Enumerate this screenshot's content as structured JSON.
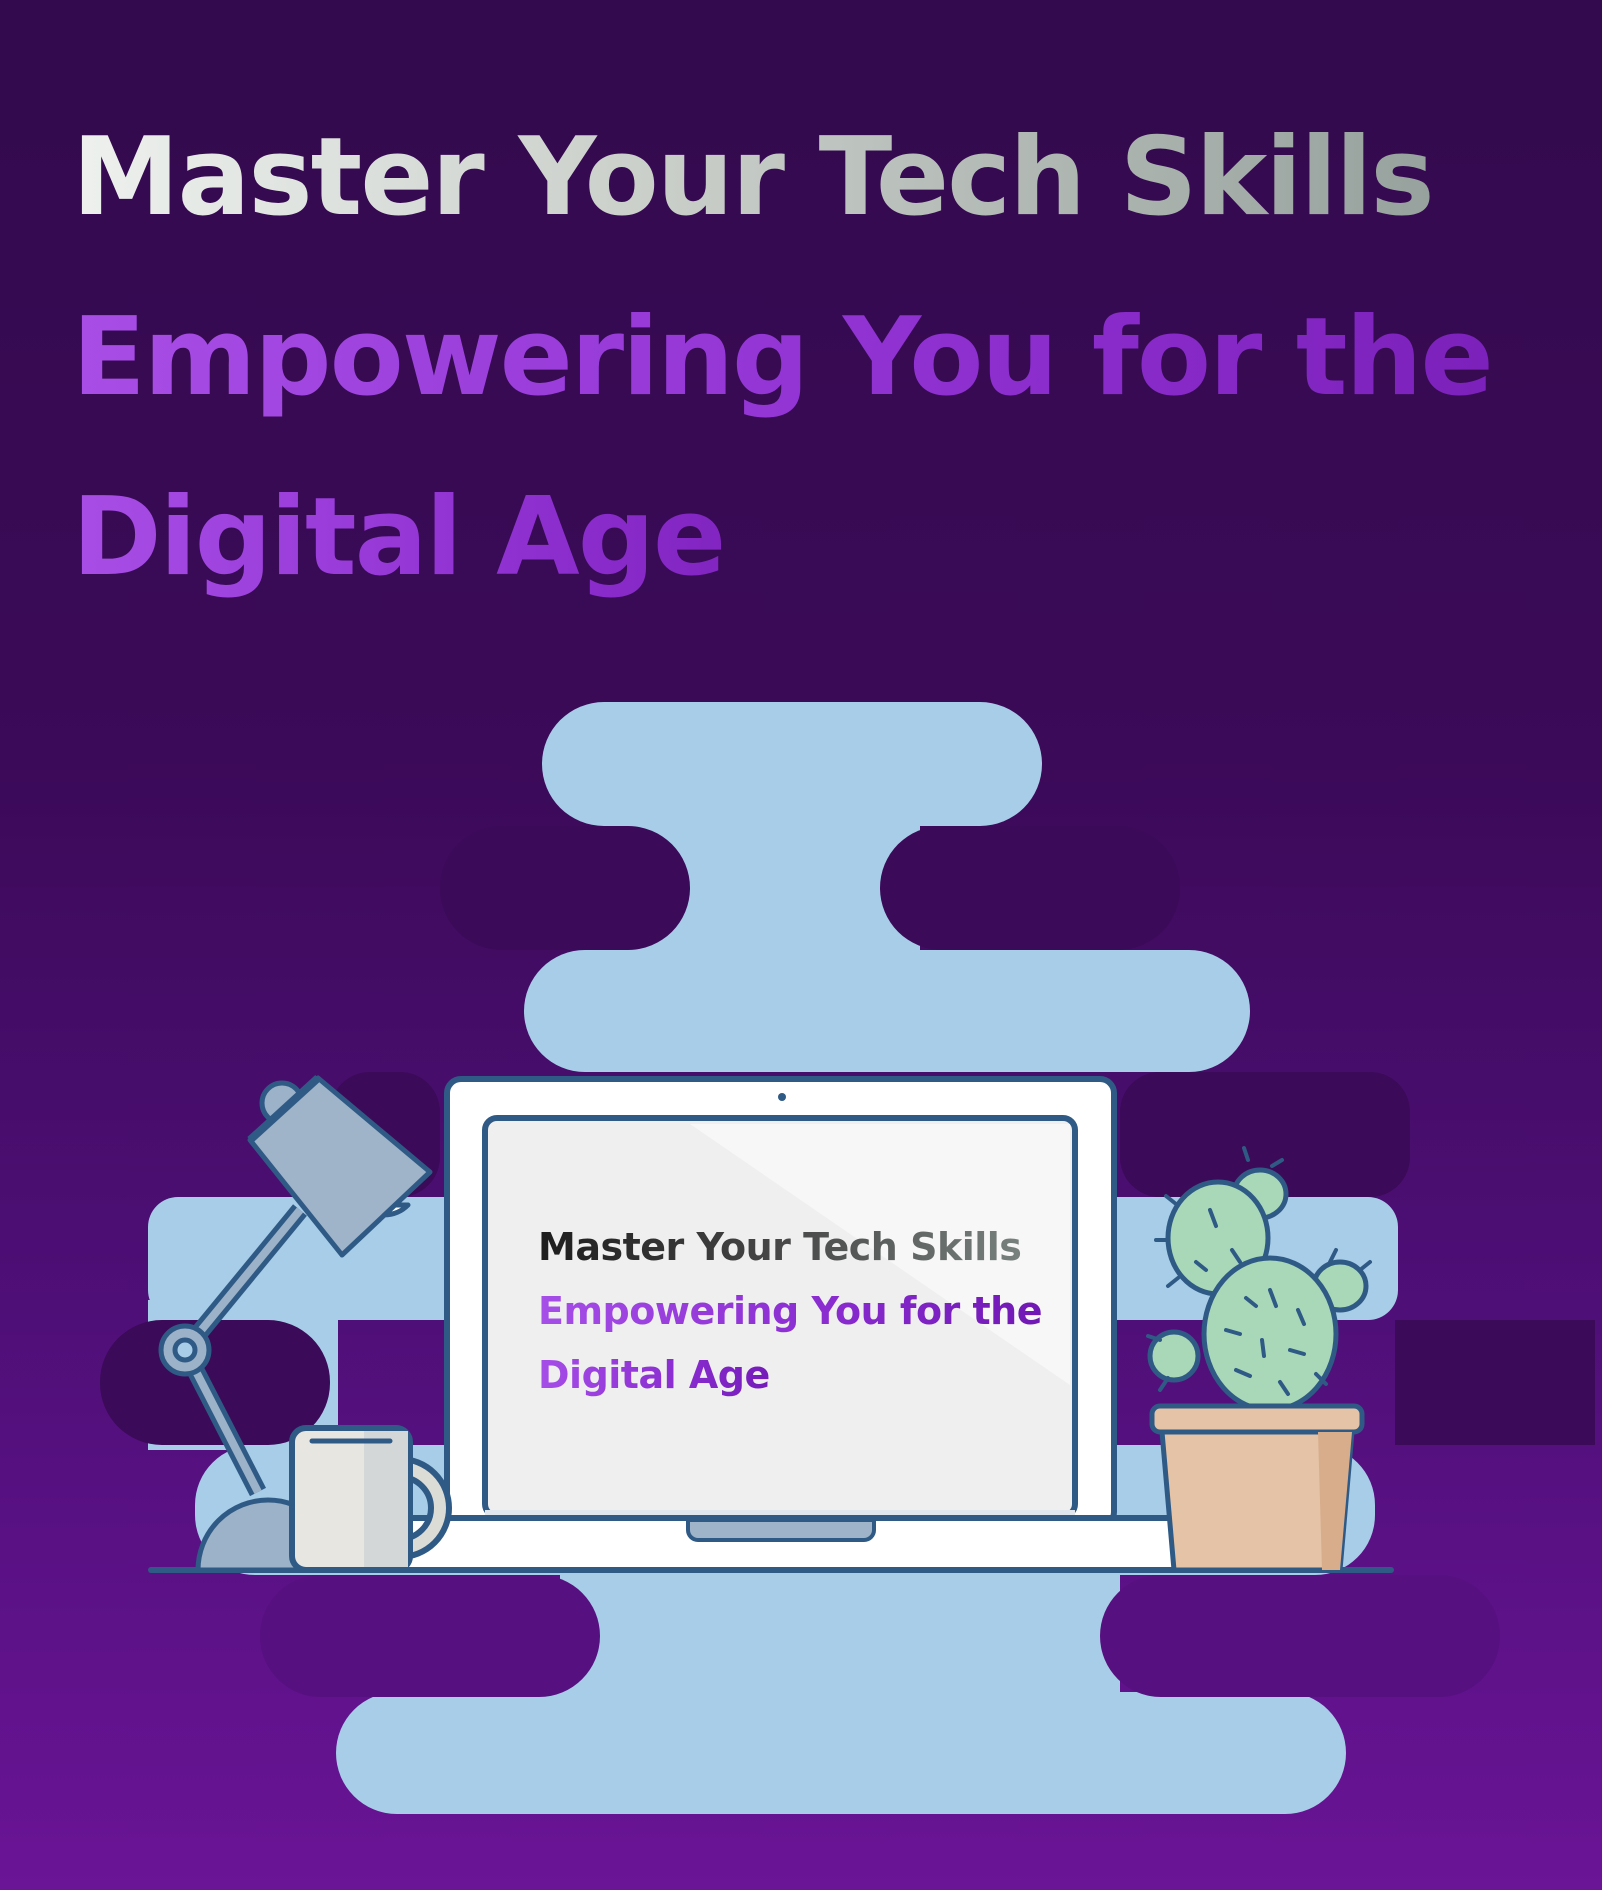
{
  "headline": {
    "line1": "Master Your Tech Skills",
    "line2": "Empowering You for the",
    "line3": "Digital Age"
  },
  "laptop_screen": {
    "line1": "Master Your Tech Skills",
    "line2": "Empowering You for the",
    "line3": "Digital Age"
  },
  "colors": {
    "background_top": "#330a4d",
    "background_bottom": "#6a1496",
    "blob": "#a7cde8",
    "outline": "#2f5a85",
    "accent_purple": "#a84ee6"
  },
  "icons": [
    "desk-lamp-icon",
    "laptop-icon",
    "coffee-mug-icon",
    "cactus-plant-icon"
  ]
}
